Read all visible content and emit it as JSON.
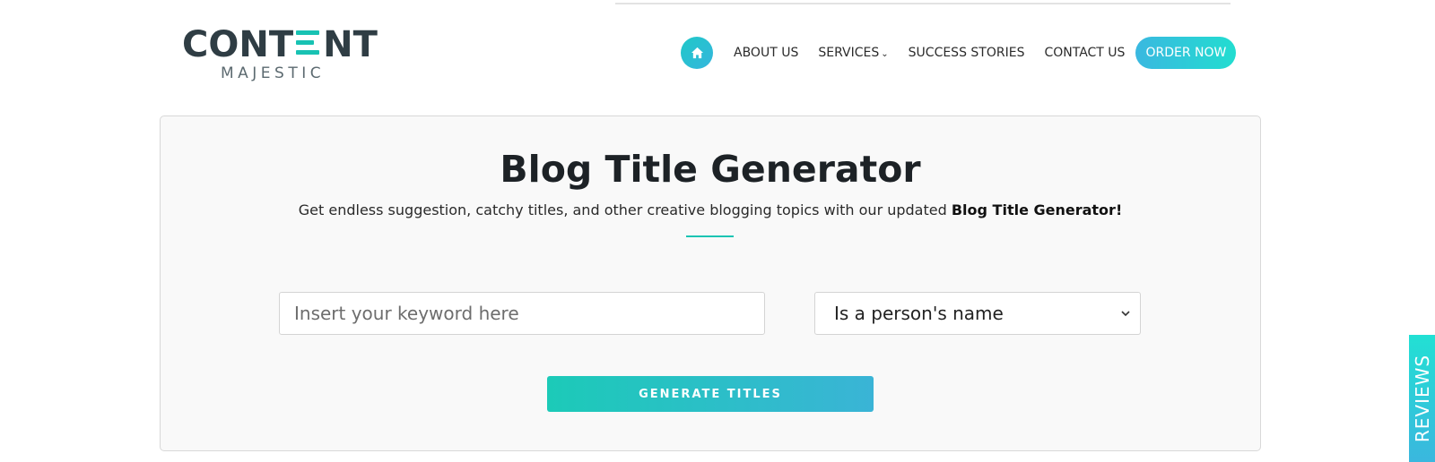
{
  "brand": {
    "logo_main_left": "CONT",
    "logo_main_right": "NT",
    "logo_sub": "MAJESTIC",
    "accent_color": "#18c2b3",
    "dark_color": "#2f3d44"
  },
  "nav": {
    "home_icon": "home-icon",
    "items": [
      {
        "label": "ABOUT US"
      },
      {
        "label": "SERVICES",
        "has_dropdown": true
      },
      {
        "label": "SUCCESS STORIES"
      },
      {
        "label": "CONTACT US"
      }
    ],
    "cta_label": "ORDER NOW"
  },
  "tool": {
    "title": "Blog Title Generator",
    "subtitle_text": "Get endless suggestion, catchy titles, and other creative blogging topics with our updated ",
    "subtitle_bold": "Blog Title Generator!",
    "keyword_placeholder": "Insert your keyword here",
    "keyword_value": "",
    "select_value": "Is a person's name",
    "generate_label": "GENERATE TITLES"
  },
  "reviews_tab": {
    "label": "REVIEWS"
  }
}
